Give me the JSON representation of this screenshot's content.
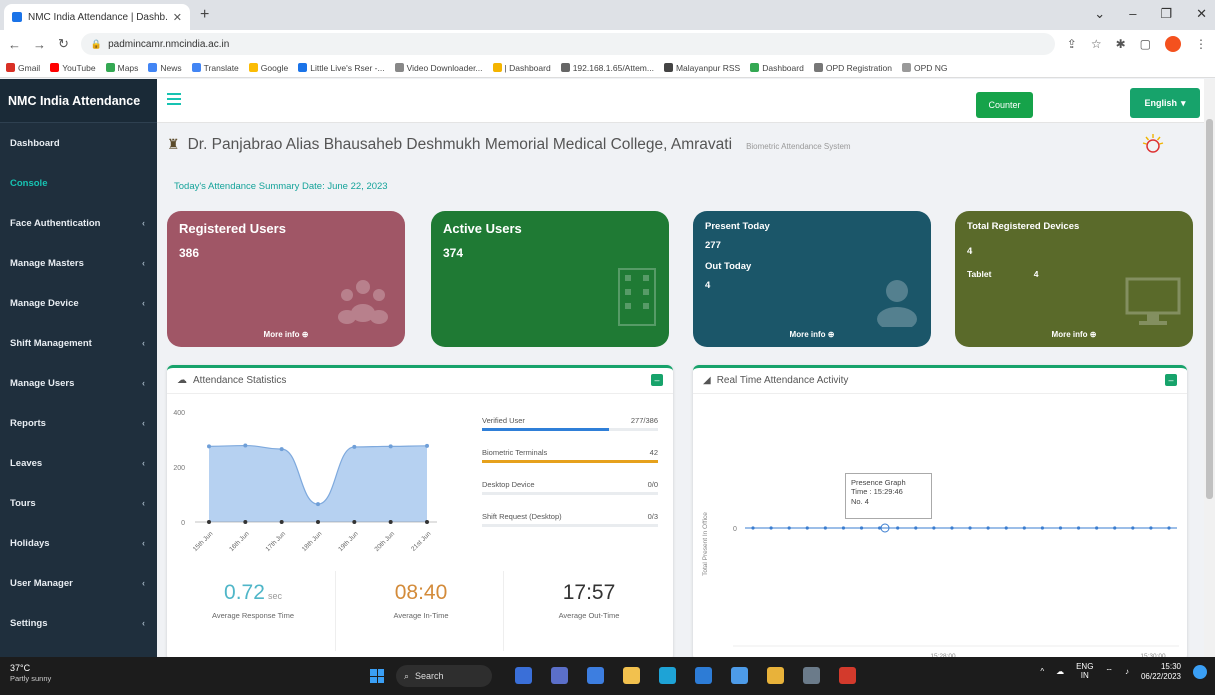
{
  "browser": {
    "tab_title": "NMC India Attendance | Dashb...",
    "url": "padmincamr.nmcindia.ac.in",
    "bookmarks": [
      "Gmail",
      "YouTube",
      "Maps",
      "News",
      "Translate",
      "Google",
      "Little Live's Rser -...",
      "Video Downloader...",
      "| Dashboard",
      "192.168.1.65/Attem...",
      "Malayanpur RSS",
      "Dashboard",
      "OPD Registration",
      "OPD NG"
    ]
  },
  "sidebar": {
    "brand": "NMC India Attendance",
    "items": [
      {
        "label": "Dashboard",
        "chev": ""
      },
      {
        "label": "Console",
        "chev": ""
      },
      {
        "label": "Face Authentication",
        "chev": "‹"
      },
      {
        "label": "Manage Masters",
        "chev": "‹"
      },
      {
        "label": "Manage Device",
        "chev": "‹"
      },
      {
        "label": "Shift Management",
        "chev": "‹"
      },
      {
        "label": "Manage Users",
        "chev": "‹"
      },
      {
        "label": "Reports",
        "chev": "‹"
      },
      {
        "label": "Leaves",
        "chev": "‹"
      },
      {
        "label": "Tours",
        "chev": "‹"
      },
      {
        "label": "Holidays",
        "chev": "‹"
      },
      {
        "label": "User Manager",
        "chev": "‹"
      },
      {
        "label": "Settings",
        "chev": "‹"
      }
    ]
  },
  "topbar": {
    "counter_label": "Counter",
    "language_label": "English"
  },
  "header": {
    "college": "Dr. Panjabrao Alias Bhausaheb Deshmukh Memorial Medical College, Amravati",
    "subtitle": "Biometric Attendance System",
    "summary": "Today's Attendance Summary Date: June 22, 2023"
  },
  "cards": {
    "registered": {
      "title": "Registered Users",
      "value": "386",
      "more": "More info ⊕",
      "color": "#a05666"
    },
    "active": {
      "title": "Active Users",
      "value": "374",
      "color": "#1f7a34"
    },
    "present": {
      "title1": "Present Today",
      "value1": "277",
      "title2": "Out Today",
      "value2": "4",
      "more": "More info ⊕",
      "color": "#1b5669"
    },
    "devices": {
      "title": "Total Registered Devices",
      "value": "4",
      "sub_label": "Tablet",
      "sub_value": "4",
      "more": "More info ⊕",
      "color": "#5a6a2a"
    }
  },
  "attendance_panel": {
    "title": "Attendance Statistics",
    "stats": [
      {
        "label": "Verified User",
        "value": "277/386",
        "fraction": 0.72,
        "color": "#2f7fd8"
      },
      {
        "label": "Biometric Terminals",
        "value": "42",
        "fraction": 1.0,
        "color": "#e6a11c"
      },
      {
        "label": "Desktop Device",
        "value": "0/0",
        "fraction": 0.0,
        "color": "#999999"
      },
      {
        "label": "Shift Request (Desktop)",
        "value": "0/3",
        "fraction": 0.0,
        "color": "#999999"
      }
    ],
    "metrics": [
      {
        "value": "0.72",
        "unit": "sec",
        "label": "Average Response Time",
        "color": "#4fb6c8"
      },
      {
        "value": "08:40",
        "unit": "",
        "label": "Average In-Time",
        "color": "#d38b3a"
      },
      {
        "value": "17:57",
        "unit": "",
        "label": "Average Out-Time",
        "color": "#333333"
      }
    ]
  },
  "realtime_panel": {
    "title": "Real Time Attendance Activity",
    "ylabel": "Total Present In Office",
    "tooltip_title": "Presence Graph",
    "tooltip_time": "Time : 15:29:46",
    "tooltip_no": "No. 4",
    "x_labels": [
      "15:28:00",
      "15:30:00"
    ]
  },
  "chart_data": [
    {
      "type": "area",
      "title": "Attendance Statistics",
      "categories": [
        "15th Jun",
        "16th Jun",
        "17th Jun",
        "18th Jun",
        "19th Jun",
        "20th Jun",
        "21st Jun"
      ],
      "values": [
        275,
        278,
        265,
        65,
        273,
        275,
        277
      ],
      "ylim": [
        0,
        400
      ],
      "yticks": [
        "400",
        "200",
        "0"
      ],
      "color": "#a9c9ee"
    },
    {
      "type": "line",
      "title": "Real Time Attendance Activity",
      "ylabel": "Total Present In Office",
      "x_labels": [
        "15:28:00",
        "15:30:00"
      ],
      "point_count": 24,
      "value": 0,
      "ytick": "0",
      "color": "#3a7dd0"
    }
  ],
  "taskbar": {
    "temp": "37°C",
    "weather": "Partly sunny",
    "search": "Search",
    "lang": "ENG",
    "lang2": "IN",
    "time": "15:30",
    "date": "06/22/2023"
  }
}
